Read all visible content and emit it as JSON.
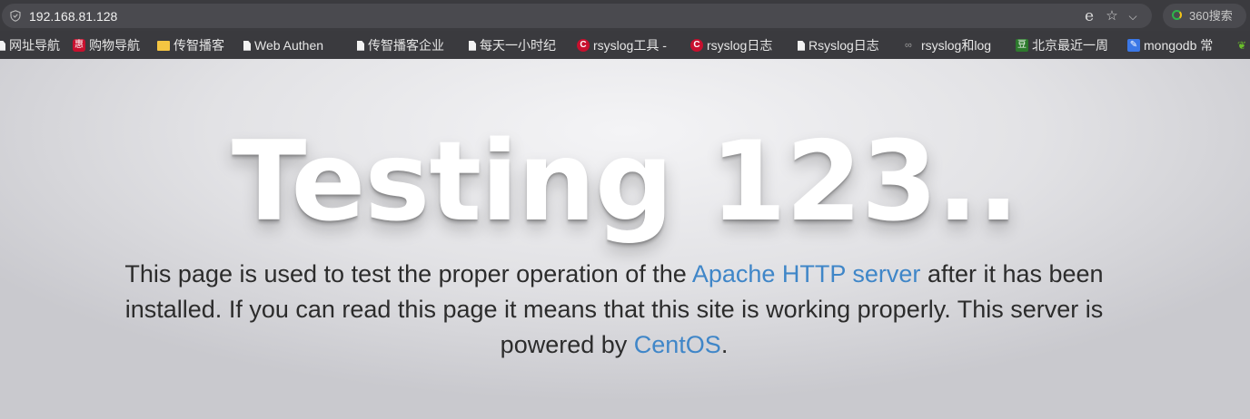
{
  "browser": {
    "url": "192.168.81.128",
    "search_placeholder": "360搜索",
    "icons": {
      "security": "shield-icon",
      "compat": "ie-icon",
      "favorite": "star-icon",
      "menu": "chevron-down-icon"
    }
  },
  "bookmarks": [
    {
      "label": "网址导航",
      "icon": "page-icon"
    },
    {
      "label": "购物导航",
      "icon": "hui-icon"
    },
    {
      "label": "传智播客",
      "icon": "folder-icon"
    },
    {
      "label": "Web Authen",
      "icon": "page-icon"
    },
    {
      "label": "传智播客企业",
      "icon": "page-icon"
    },
    {
      "label": "每天一小时纪",
      "icon": "page-icon"
    },
    {
      "label": "rsyslog工具 -",
      "icon": "csdn-icon"
    },
    {
      "label": "rsyslog日志",
      "icon": "csdn-icon"
    },
    {
      "label": "Rsyslog日志",
      "icon": "page-icon"
    },
    {
      "label": "rsyslog和log",
      "icon": "link-icon"
    },
    {
      "label": "北京最近一周",
      "icon": "douban-icon"
    },
    {
      "label": "mongodb 常",
      "icon": "pen-icon"
    },
    {
      "label": "",
      "icon": "leaf-icon"
    }
  ],
  "page": {
    "headline": "Testing 123..",
    "paragraph_part1": "This page is used to test the proper operation of the ",
    "apache_link": "Apache HTTP server",
    "paragraph_part2": " after it has been installed. If you can read this page it means that this site is working properly. This server is powered by ",
    "centos_link": "CentOS",
    "paragraph_end": "."
  },
  "colors": {
    "link": "#3f86c8",
    "text": "#2c2c2c",
    "headline": "#ffffff",
    "toolbar": "#3a3a3e"
  }
}
